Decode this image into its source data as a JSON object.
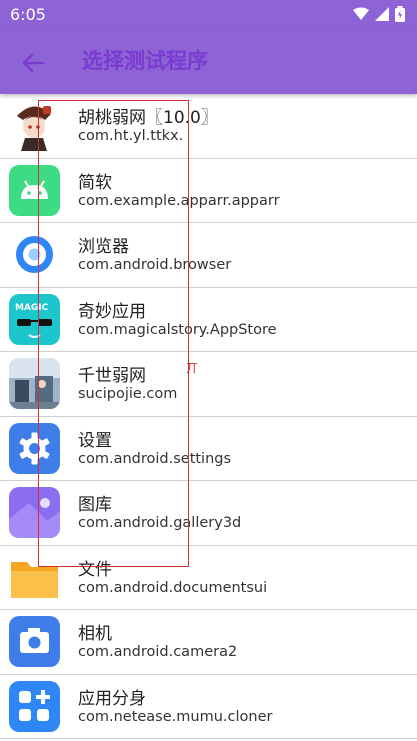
{
  "status_bar": {
    "time": "6:05"
  },
  "header": {
    "title": "选择测试程序"
  },
  "apps": [
    {
      "name": "胡桃弱网〖10.0〗",
      "package": "com.ht.yl.ttkx."
    },
    {
      "name": "简软",
      "package": "com.example.apparr.apparr"
    },
    {
      "name": "浏览器",
      "package": "com.android.browser"
    },
    {
      "name": "奇妙应用",
      "package": "com.magicalstory.AppStore"
    },
    {
      "name": "千世弱网",
      "package": "sucipojie.com"
    },
    {
      "name": "设置",
      "package": "com.android.settings"
    },
    {
      "name": "图库",
      "package": "com.android.gallery3d"
    },
    {
      "name": "文件",
      "package": "com.android.documentsui"
    },
    {
      "name": "相机",
      "package": "com.android.camera2"
    },
    {
      "name": "应用分身",
      "package": "com.netease.mumu.cloner"
    }
  ],
  "overlay": {
    "marker_text": "丌"
  },
  "colors": {
    "appbar": "#8e63d6",
    "title": "#7a3bd1",
    "overlay_border": "#d03030"
  }
}
